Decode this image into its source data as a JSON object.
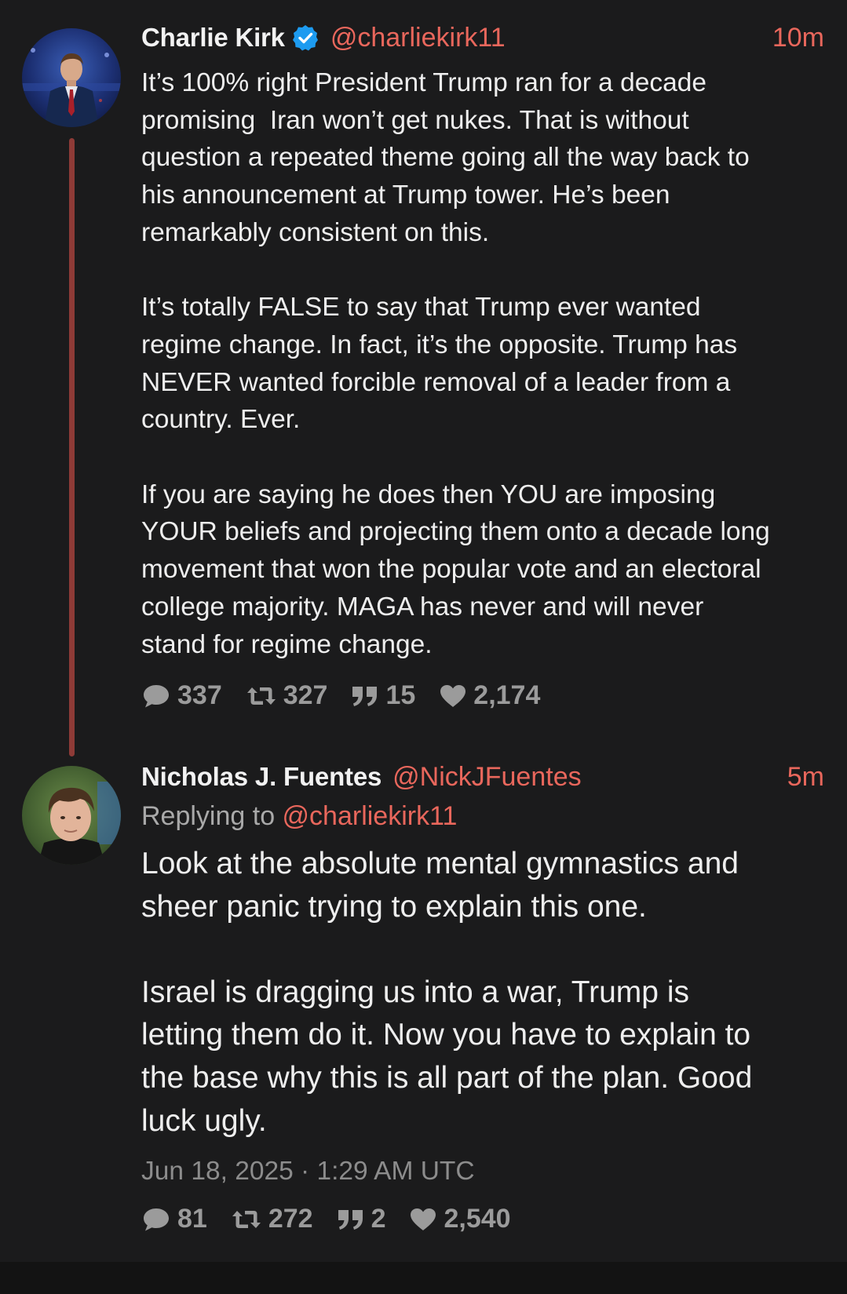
{
  "tweets": [
    {
      "display_name": "Charlie Kirk",
      "verified_icon": "verified-badge-icon",
      "handle": "@charliekirk11",
      "time": "10m",
      "paragraphs": [
        "It’s 100% right President Trump ran for a decade\npromising  Iran won’t get nukes. That is without\nquestion a repeated theme going all the way back to\nhis announcement at Trump tower. He’s been\nremarkably consistent on this.",
        "It’s totally FALSE to say that Trump ever wanted\nregime change. In fact, it’s the opposite. Trump has\nNEVER wanted forcible removal of a leader from a\ncountry. Ever.",
        "If you are saying he does then YOU are imposing\nYOUR beliefs and projecting them onto a decade long\nmovement that won the popular vote and an electoral\ncollege majority. MAGA has never and will never\nstand for regime change."
      ],
      "stats": {
        "replies": "337",
        "retweets": "327",
        "quotes": "15",
        "likes": "2,174"
      }
    },
    {
      "display_name": "Nicholas J. Fuentes",
      "handle": "@NickJFuentes",
      "time": "5m",
      "replying_prefix": "Replying to ",
      "replying_handle": "@charliekirk11",
      "paragraphs": [
        "Look at the absolute mental gymnastics and\nsheer panic trying to explain this one.",
        "Israel is dragging us into a war, Trump is\nletting them do it. Now you have to explain to\nthe base why this is all part of the plan. Good\nluck ugly."
      ],
      "date": "Jun 18, 2025 · 1:29 AM UTC",
      "stats": {
        "replies": "81",
        "retweets": "272",
        "quotes": "2",
        "likes": "2,540"
      }
    }
  ],
  "icons": {
    "reply": "comment-bubble-icon",
    "retweet": "retweet-icon",
    "quote": "quote-icon",
    "like": "heart-icon"
  },
  "colors": {
    "background": "#1b1b1c",
    "accent": "#e9675c",
    "thread_line": "#8e3b37",
    "verified": "#1d9bf0",
    "muted": "#9b9b9b"
  }
}
